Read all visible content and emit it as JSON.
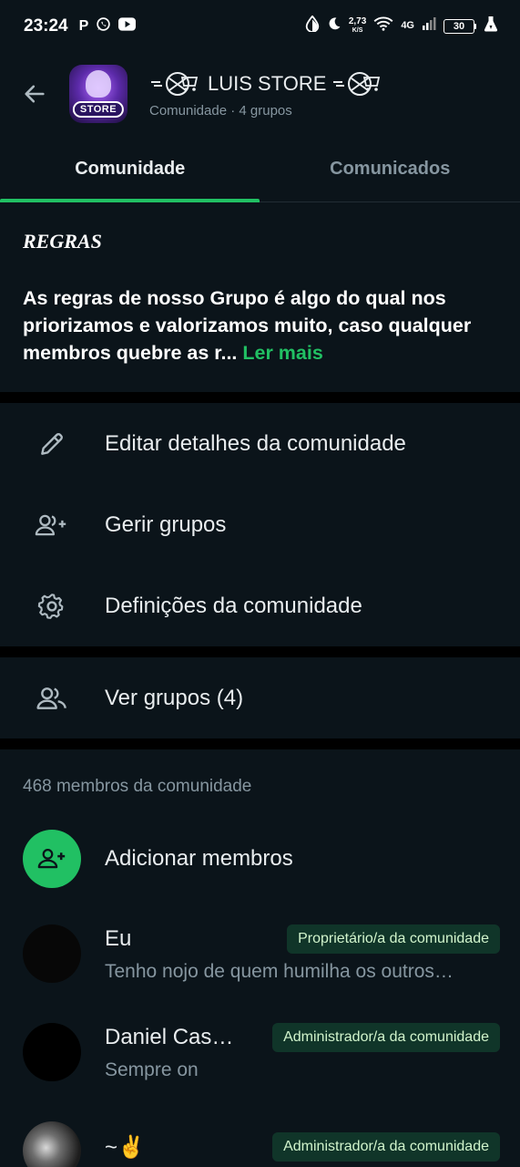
{
  "status_bar": {
    "time": "23:24",
    "app_icons": [
      "P",
      "whatsapp-icon",
      "youtube-icon"
    ],
    "speed_value": "2,73",
    "speed_unit": "K/S",
    "network": "4G",
    "battery": "30"
  },
  "header": {
    "title": "LUIS STORE",
    "subtitle": "Comunidade · 4 grupos",
    "avatar_text": "STORE"
  },
  "tabs": [
    {
      "label": "Comunidade",
      "active": true
    },
    {
      "label": "Comunicados",
      "active": false
    }
  ],
  "rules": {
    "title": "REGRAS",
    "body": "As regras de nosso Grupo é algo do qual nos priorizamos e valorizamos muito, caso qualquer membros quebre as r... ",
    "read_more": "Ler mais"
  },
  "actions": {
    "edit": "Editar detalhes da comunidade",
    "manage": "Gerir grupos",
    "settings": "Definições da comunidade",
    "view_groups": "Ver grupos (4)"
  },
  "members": {
    "count_label": "468 membros da comunidade",
    "add_label": "Adicionar membros",
    "list": [
      {
        "name": "Eu",
        "status": "Tenho nojo de quem humilha os outros…",
        "badge": "Proprietário/a da comunidade"
      },
      {
        "name": "Daniel Cas…",
        "status": "Sempre on",
        "badge": "Administrador/a da comunidade"
      },
      {
        "name": "~✌️",
        "status": "",
        "badge": "Administrador/a da comunidade"
      }
    ]
  },
  "colors": {
    "background": "#0b141a",
    "accent": "#21c063",
    "badge_bg": "#103529",
    "muted_text": "#8696a0"
  }
}
